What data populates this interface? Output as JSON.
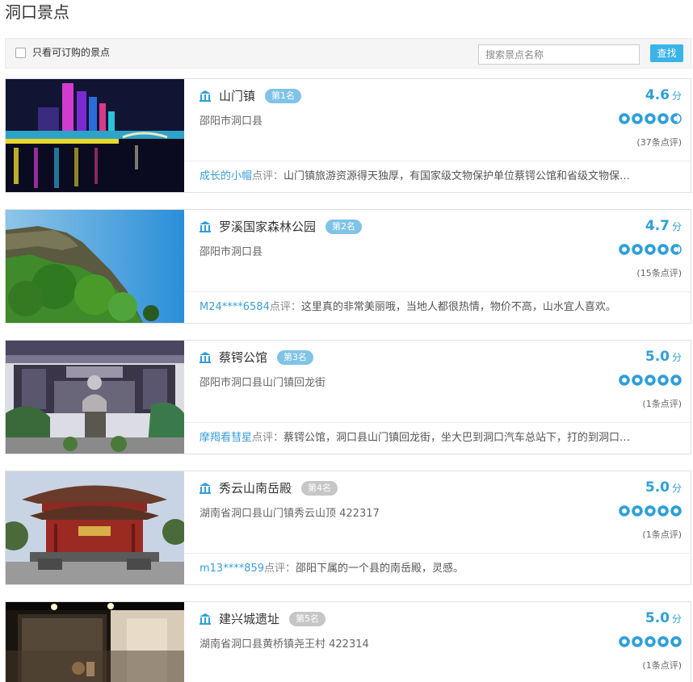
{
  "page": {
    "title": "洞口景点"
  },
  "filter": {
    "checkbox_label": "只看可订购的景点",
    "search_placeholder": "搜索景点名称",
    "search_button": "查找"
  },
  "colors": {
    "accent": "#2f9fd8",
    "button": "#3ab4e8",
    "rank_top": "#7fc3e6",
    "rank_other": "#c6c6c6"
  },
  "review_tag": "点评：",
  "score_unit": "分",
  "attractions": [
    {
      "name": "山门镇",
      "rank": "第1名",
      "address": "邵阳市洞口县",
      "score": "4.6",
      "rating": 4.6,
      "review_count": "(37条点评)",
      "reviewer": "成长的小帽",
      "review": "山门镇旅游资源得天独厚，有国家级文物保护单位蔡锷公馆和省级文物保…",
      "icon": "landmark-icon",
      "image": "night-river-town"
    },
    {
      "name": "罗溪国家森林公园",
      "rank": "第2名",
      "address": "邵阳市洞口县",
      "score": "4.7",
      "rating": 4.7,
      "review_count": "(15条点评)",
      "reviewer": "M24****6584",
      "review": "这里真的非常美丽哦，当地人都很热情，物价不高，山水宜人喜欢。",
      "icon": "landmark-icon",
      "image": "forest-cliff"
    },
    {
      "name": "蔡锷公馆",
      "rank": "第3名",
      "address": "邵阳市洞口县山门镇回龙街",
      "score": "5.0",
      "rating": 5.0,
      "review_count": "(1条点评)",
      "reviewer": "摩羯看彗星",
      "review": "蔡锷公馆，洞口县山门镇回龙街，坐大巴到洞口汽车总站下，打的到洞口…",
      "icon": "landmark-icon",
      "image": "statue-courtyard"
    },
    {
      "name": "秀云山南岳殿",
      "rank": "第4名",
      "address": "湖南省洞口县山门镇秀云山顶 422317",
      "score": "5.0",
      "rating": 5.0,
      "review_count": "(1条点评)",
      "reviewer": "m13****859",
      "review": "邵阳下属的一个县的南岳殿，灵感。",
      "icon": "landmark-icon",
      "image": "red-temple"
    },
    {
      "name": "建兴城遗址",
      "rank": "第5名",
      "address": "湖南省洞口县黄桥镇尧王村 422314",
      "score": "5.0",
      "rating": 5.0,
      "review_count": "(1条点评)",
      "reviewer": "",
      "review": "",
      "icon": "landmark-icon",
      "image": "museum-display"
    }
  ]
}
